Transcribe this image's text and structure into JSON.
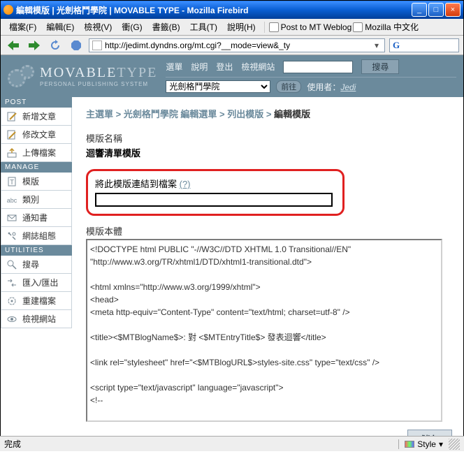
{
  "window": {
    "title": "編輯模版 | 光劍格鬥學院 | MOVABLE TYPE - Mozilla Firebird",
    "min": "_",
    "max": "□",
    "close": "×"
  },
  "menu": {
    "file": "檔案(F)",
    "edit": "編輯(E)",
    "view": "檢視(V)",
    "go": "衝(G)",
    "bookmarks": "書籤(B)",
    "tools": "工具(T)",
    "help": "說明(H)",
    "bm1": "Post to MT Weblog",
    "bm2": "Mozilla 中文化"
  },
  "toolbar": {
    "url": "http://jedimt.dyndns.org/mt.cgi?__mode=view&_ty",
    "gicon": "G"
  },
  "header": {
    "logo_main": "MOVABLE",
    "logo_type": "TYPE",
    "logo_sub": "PERSONAL PUBLISHING SYSTEM",
    "nav_menu": "選單",
    "nav_help": "說明",
    "nav_logout": "登出",
    "nav_view": "檢視網站",
    "search_btn": "搜尋",
    "blog_select": "光劍格鬥學院",
    "go_btn": "前往",
    "user_label": "使用者：",
    "user_name": "Jedi"
  },
  "sidebar": {
    "post_header": "POST",
    "post": [
      {
        "label": "新增文章"
      },
      {
        "label": "修改文章"
      },
      {
        "label": "上傳檔案"
      }
    ],
    "manage_header": "MANAGE",
    "manage": [
      {
        "label": "模版"
      },
      {
        "label": "類別"
      },
      {
        "label": "通知書"
      },
      {
        "label": "網誌組態"
      }
    ],
    "util_header": "UTILITIES",
    "util": [
      {
        "label": "搜尋"
      },
      {
        "label": "匯入/匯出"
      },
      {
        "label": "重建檔案"
      },
      {
        "label": "檢視網站"
      }
    ]
  },
  "main": {
    "breadcrumb": "主選單 > 光劍格鬥學院 編輯選單 > 列出模版 > ",
    "breadcrumb_cur": "編輯模版",
    "name_label": "模版名稱",
    "name_value": "迴響清單模版",
    "link_label": "將此模版連結到檔案 ",
    "link_help": "(?)",
    "link_value": "",
    "body_label": "模版本體",
    "body_value": "<!DOCTYPE html PUBLIC \"-//W3C//DTD XHTML 1.0 Transitional//EN\"\n\"http://www.w3.org/TR/xhtml1/DTD/xhtml1-transitional.dtd\">\n\n<html xmlns=\"http://www.w3.org/1999/xhtml\">\n<head>\n<meta http-equiv=\"Content-Type\" content=\"text/html; charset=utf-8\" />\n\n<title><$MTBlogName$>: 對 <$MTEntryTitle$> 發表迴響</title>\n\n<link rel=\"stylesheet\" href=\"<$MTBlogURL$>styles-site.css\" type=\"text/css\" />\n\n<script type=\"text/javascript\" language=\"javascript\">\n<!--\n\nvar HOST = '<$MTBlogHost$>';\n\n// Copyright (c) 1996-1997 Athenia Associates.\n// http://www.webreference.com/js/\n// License is granted if and only if this entire\n// copyright notice is included. By Tomer Shiran.",
    "save_btn": "儲存"
  },
  "status": {
    "text": "完成",
    "style": "Style"
  }
}
